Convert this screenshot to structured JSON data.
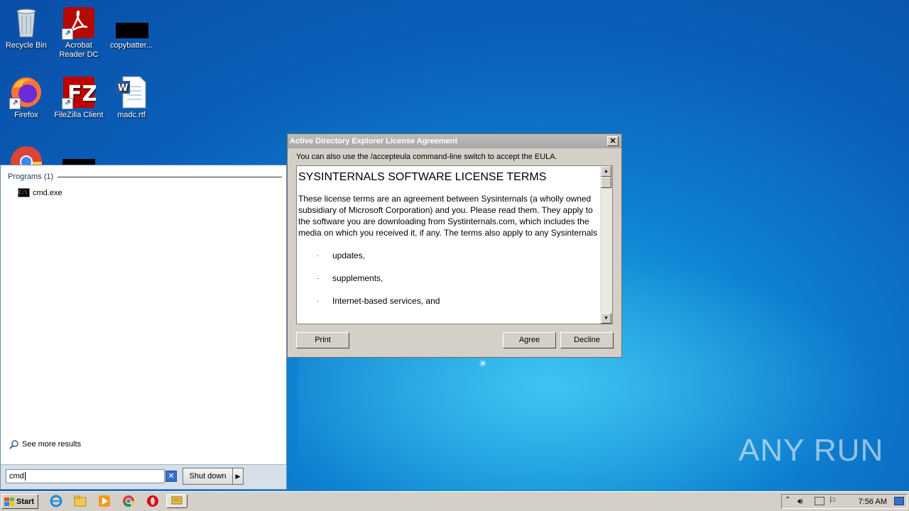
{
  "desktop": {
    "icons": [
      {
        "label": "Recycle Bin"
      },
      {
        "label": "Acrobat Reader DC"
      },
      {
        "label": "copybatter..."
      },
      {
        "label": "Firefox"
      },
      {
        "label": "FileZilla Client"
      },
      {
        "label": "madc.rtf"
      }
    ],
    "watermark": "ANY RUN"
  },
  "start_menu": {
    "group_label": "Programs (1)",
    "program": "cmd.exe",
    "see_more": "See more results",
    "search_value": "cmd",
    "shutdown_label": "Shut down"
  },
  "dialog": {
    "title": "Active Directory Explorer License Agreement",
    "hint": "You can also use the /accepteula command-line switch to accept the EULA.",
    "heading": "SYSINTERNALS SOFTWARE LICENSE TERMS",
    "paragraph": "These license terms are an agreement between Sysinternals (a wholly owned subsidiary of Microsoft Corporation) and you.  Please read them. They apply to the software you are downloading from Systinternals.com, which includes the media on which you received it, if any.  The terms also apply to any Sysinternals",
    "bullets": [
      "updates,",
      "supplements,",
      "Internet-based services, and"
    ],
    "buttons": {
      "print": "Print",
      "agree": "Agree",
      "decline": "Decline"
    }
  },
  "taskbar": {
    "start_label": "Start",
    "clock": "7:56 AM"
  }
}
